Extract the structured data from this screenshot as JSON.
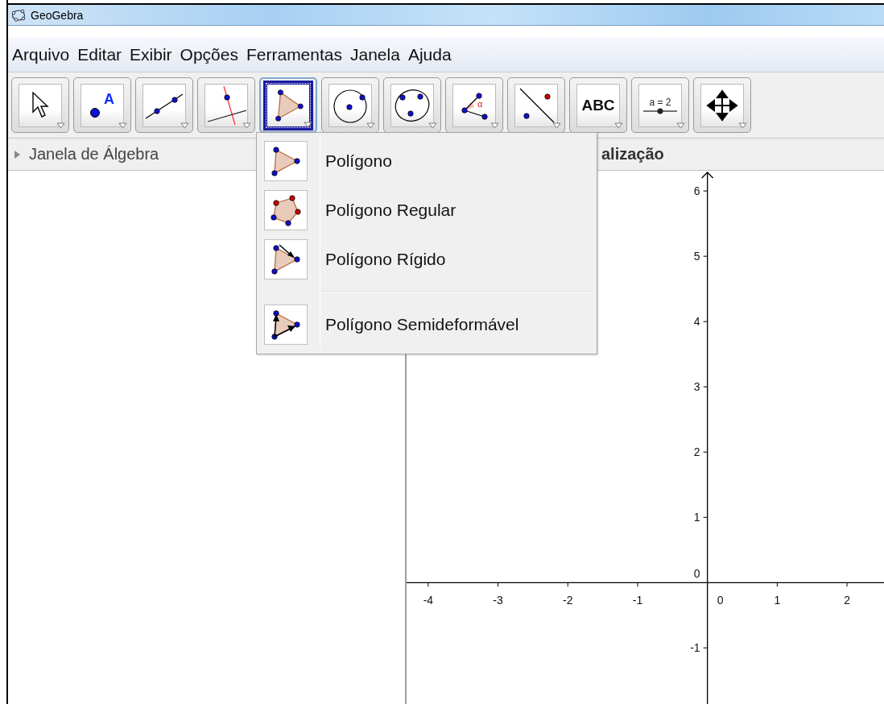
{
  "window": {
    "title": "GeoGebra"
  },
  "menu": [
    "Arquivo",
    "Editar",
    "Exibir",
    "Opções",
    "Ferramentas",
    "Janela",
    "Ajuda"
  ],
  "toolbar": [
    {
      "kind": "pointer",
      "selected": false
    },
    {
      "kind": "point",
      "label": "A",
      "selected": false
    },
    {
      "kind": "line",
      "selected": false
    },
    {
      "kind": "perpendicular",
      "selected": false
    },
    {
      "kind": "polygon",
      "selected": true
    },
    {
      "kind": "circle",
      "selected": false
    },
    {
      "kind": "conic",
      "selected": false
    },
    {
      "kind": "angle",
      "label": "α",
      "selected": false
    },
    {
      "kind": "reflect",
      "selected": false
    },
    {
      "kind": "text",
      "label": "ABC",
      "selected": false
    },
    {
      "kind": "slider",
      "label": "a = 2",
      "selected": false
    },
    {
      "kind": "move-view",
      "selected": false
    }
  ],
  "algebra_view": {
    "title": "Janela de Álgebra",
    "expanded": false
  },
  "graphics_view": {
    "title": "alização",
    "origin_labels": [
      "0",
      "0"
    ],
    "chart_data": {
      "type": "scatter",
      "xlim": [
        -4.31,
        2.53
      ],
      "ylim": [
        -1.86,
        6.31
      ],
      "xticks": [
        -4,
        -3,
        -2,
        -1,
        1,
        2
      ],
      "yticks": [
        -1,
        1,
        2,
        3,
        4,
        5,
        6
      ]
    }
  },
  "dropdown": {
    "items": [
      {
        "kind": "polygon",
        "label": "Polígono"
      },
      {
        "kind": "regular-polygon",
        "label": "Polígono Regular"
      },
      {
        "kind": "rigid-polygon",
        "label": "Polígono Rígido"
      },
      {
        "kind": "vector-polygon",
        "label": "Polígono Semideformável",
        "separator_before": true
      }
    ]
  }
}
